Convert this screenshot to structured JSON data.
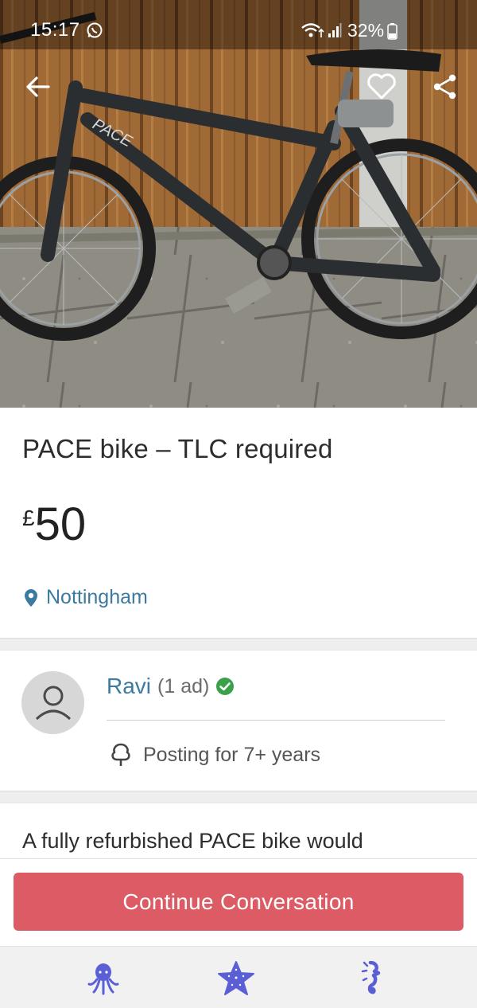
{
  "status_bar": {
    "time": "15:17",
    "battery": "32%",
    "icons": [
      "whatsapp-icon",
      "wifi-icon",
      "signal-icon",
      "battery-icon"
    ]
  },
  "header_icons": [
    "back-arrow-icon",
    "heart-icon",
    "share-icon"
  ],
  "listing": {
    "title": "PACE bike – TLC required",
    "price_currency": "£",
    "price_amount": "50",
    "location": "Nottingham"
  },
  "seller": {
    "name": "Ravi",
    "ads_count": "(1 ad)",
    "posting_since": "Posting for 7+ years"
  },
  "description": {
    "text": "A fully refurbished PACE bike would"
  },
  "cta": {
    "label": "Continue Conversation"
  },
  "bottom_nav": [
    "octopus-icon",
    "starfish-icon",
    "seahorse-icon"
  ],
  "colors": {
    "accent_link": "#3b7aa1",
    "cta": "#dd5b64",
    "verified": "#3aa14a",
    "nav_icon": "#5b5fd6"
  }
}
